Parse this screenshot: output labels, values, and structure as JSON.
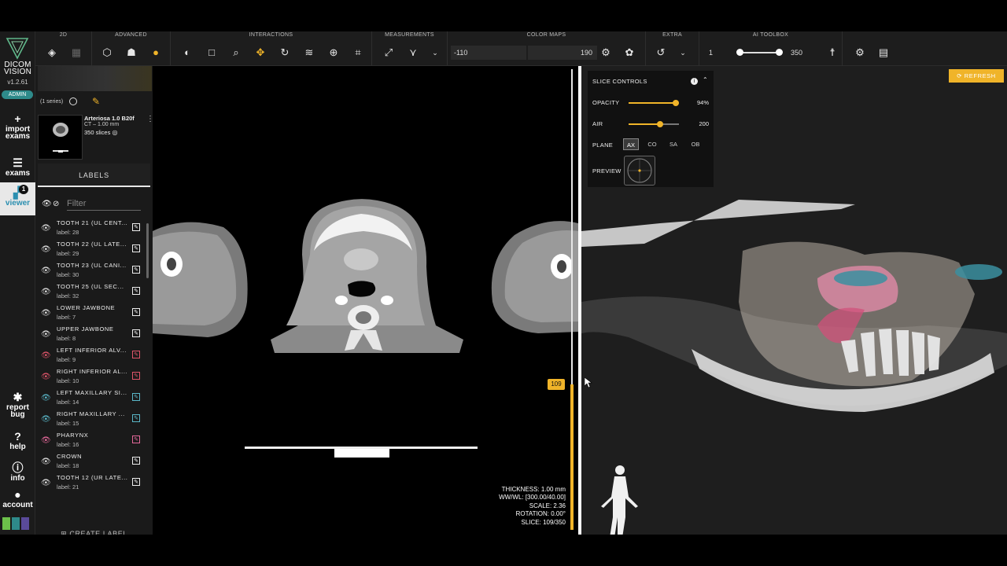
{
  "app": {
    "brand_line1": "DICOM",
    "brand_line2": "VISION",
    "version": "v1.2.61",
    "role": "ADMIN"
  },
  "nav": {
    "import": "import exams",
    "exams": "exams",
    "viewer": "viewer",
    "viewer_badge": "1",
    "report": "report bug",
    "help": "help",
    "info": "info",
    "account": "account"
  },
  "toolbar": {
    "groups": {
      "g2d": "2D",
      "advanced": "ADVANCED",
      "interactions": "INTERACTIONS",
      "measurements": "MEASUREMENTS",
      "color_maps": "COLOR MAPS",
      "extra": "EXTRA",
      "ai_toolbox": "AI TOOLBOX"
    },
    "colormap_min": "-110",
    "colormap_max": "190",
    "ai_min": "1",
    "ai_max": "350"
  },
  "sidebar": {
    "series_count": "(1 series)",
    "series_title": "Arteriosa 1.0 B20f",
    "series_sub": "CT – 1.00 mm",
    "series_slices": "350 slices",
    "labels_header": "LABELS",
    "filter_placeholder": "Filter",
    "create_label": "CREATE LABEL",
    "labels": [
      {
        "name": "TOOTH 21 (UL CENT...",
        "sub": "label: 28"
      },
      {
        "name": "TOOTH 22 (UL LATE...",
        "sub": "label: 29"
      },
      {
        "name": "TOOTH 23 (UL CANI...",
        "sub": "label: 30"
      },
      {
        "name": "TOOTH 25 (UL SEC...",
        "sub": "label: 32"
      },
      {
        "name": "LOWER JAWBONE",
        "sub": "label: 7"
      },
      {
        "name": "UPPER JAWBONE",
        "sub": "label: 8"
      },
      {
        "name": "LEFT INFERIOR ALV...",
        "sub": "label: 9"
      },
      {
        "name": "RIGHT INFERIOR AL...",
        "sub": "label: 10"
      },
      {
        "name": "LEFT MAXILLARY SI...",
        "sub": "label: 14"
      },
      {
        "name": "RIGHT MAXILLARY ...",
        "sub": "label: 15"
      },
      {
        "name": "PHARYNX",
        "sub": "label: 16"
      },
      {
        "name": "CROWN",
        "sub": "label: 18"
      },
      {
        "name": "TOOTH 12 (UR LATE...",
        "sub": "label: 21"
      }
    ]
  },
  "ct_view": {
    "slice_tag": "109",
    "thickness": "THICKNESS: 1.00 mm",
    "wwwl": "WW/WL: [300.00/40.00]",
    "scale": "SCALE: 2.36",
    "rotation": "ROTATION: 0.00°",
    "slice": "SLICE: 109/350"
  },
  "slice_controls": {
    "title": "SLICE CONTROLS",
    "opacity_label": "OPACITY",
    "opacity_value": "94%",
    "opacity_fraction": 0.94,
    "air_label": "AIR",
    "air_value": "200",
    "air_fraction": 0.62,
    "plane_label": "PLANE",
    "planes": [
      "AX",
      "CO",
      "SA",
      "OB"
    ],
    "preview_label": "PREVIEW",
    "refresh": "REFRESH"
  },
  "colors": {
    "accent": "#f0b429",
    "teal": "#2e8a8a",
    "red_label": "#e0556a",
    "maxillary": "#5ab7c8",
    "pharynx": "#e4689a"
  }
}
